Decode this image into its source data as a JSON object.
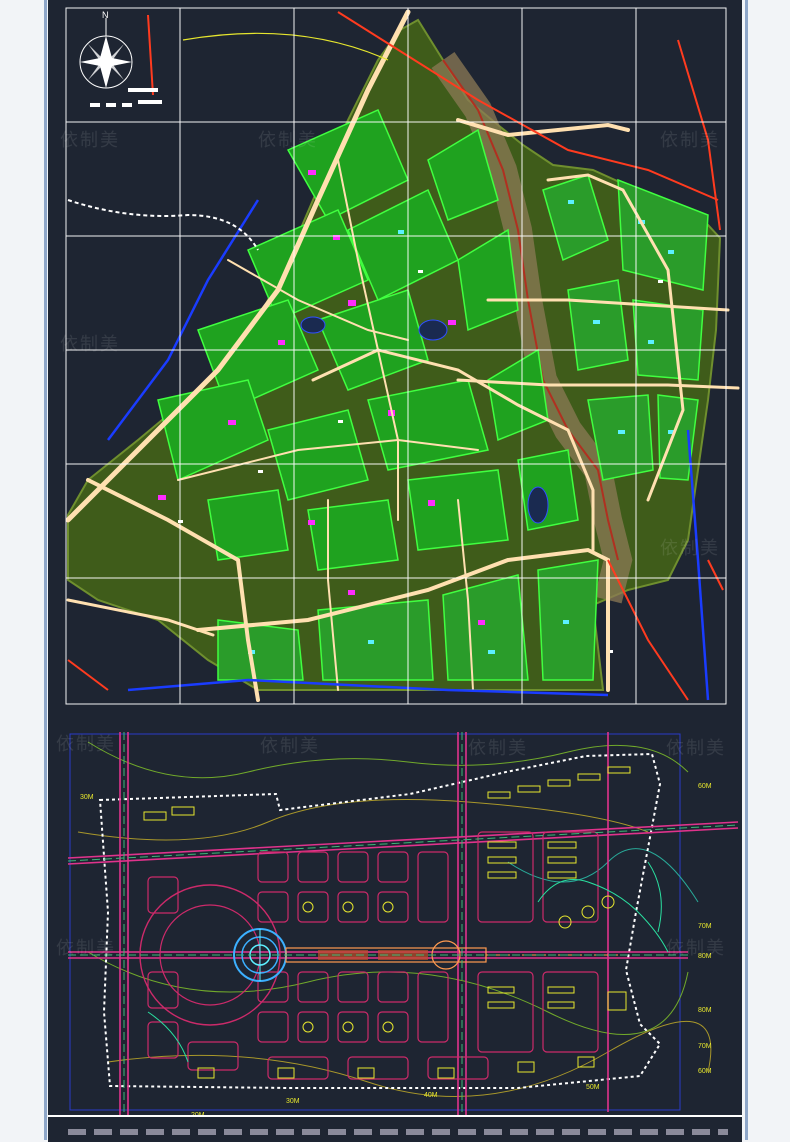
{
  "watermark_text": "依制美",
  "map1": {
    "north_label": "N"
  },
  "map2": {
    "road_width_labels": {
      "left_top": "30M",
      "right_1": "60M",
      "right_2": "70M",
      "right_3": "80M",
      "right_4": "80M",
      "right_5": "70M",
      "right_6": "60M",
      "bottom_1": "20M",
      "bottom_2": "30M",
      "bottom_3": "40M",
      "bottom_4": "50M"
    }
  },
  "colors": {
    "background": "#1e2532",
    "grid": "#ffffff",
    "green_land": "#4a6a1e",
    "bright_green": "#22ff22",
    "road": "#ffd9a0",
    "accent_red": "#ff3b1f",
    "blue_line": "#1a3cff"
  }
}
